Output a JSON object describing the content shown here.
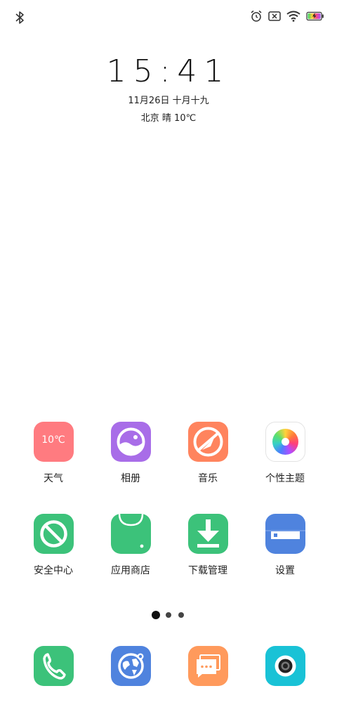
{
  "status_bar": {
    "left_icons": [
      "bluetooth-icon"
    ],
    "right_icons": [
      "alarm-icon",
      "no-sim-icon",
      "wifi-icon",
      "battery-charging-icon"
    ]
  },
  "lock_clock": {
    "time": "15:41",
    "date": "11月26日 十月十九",
    "weather": "北京 晴 10℃"
  },
  "apps": [
    {
      "label": "天气",
      "icon": "weather-icon",
      "icon_text": "10℃",
      "color": "#FF7B80"
    },
    {
      "label": "相册",
      "icon": "gallery-icon",
      "color": "#A86DE8"
    },
    {
      "label": "音乐",
      "icon": "music-icon",
      "color": "#FF845E"
    },
    {
      "label": "个性主题",
      "icon": "theme-icon",
      "color": "#FFFFFF"
    },
    {
      "label": "安全中心",
      "icon": "security-icon",
      "color": "#3CC27A"
    },
    {
      "label": "应用商店",
      "icon": "app-store-icon",
      "color": "#3CC27A"
    },
    {
      "label": "下载管理",
      "icon": "download-icon",
      "color": "#3CC27A"
    },
    {
      "label": "设置",
      "icon": "settings-icon",
      "color": "#4F83DE"
    }
  ],
  "pager": {
    "pages": 3,
    "current": 1
  },
  "dock": [
    {
      "icon": "phone-icon",
      "color": "#3CC27A"
    },
    {
      "icon": "browser-icon",
      "color": "#4F83DE"
    },
    {
      "icon": "messages-icon",
      "color": "#FF9A5C"
    },
    {
      "icon": "camera-icon",
      "color": "#19C2D6"
    }
  ]
}
